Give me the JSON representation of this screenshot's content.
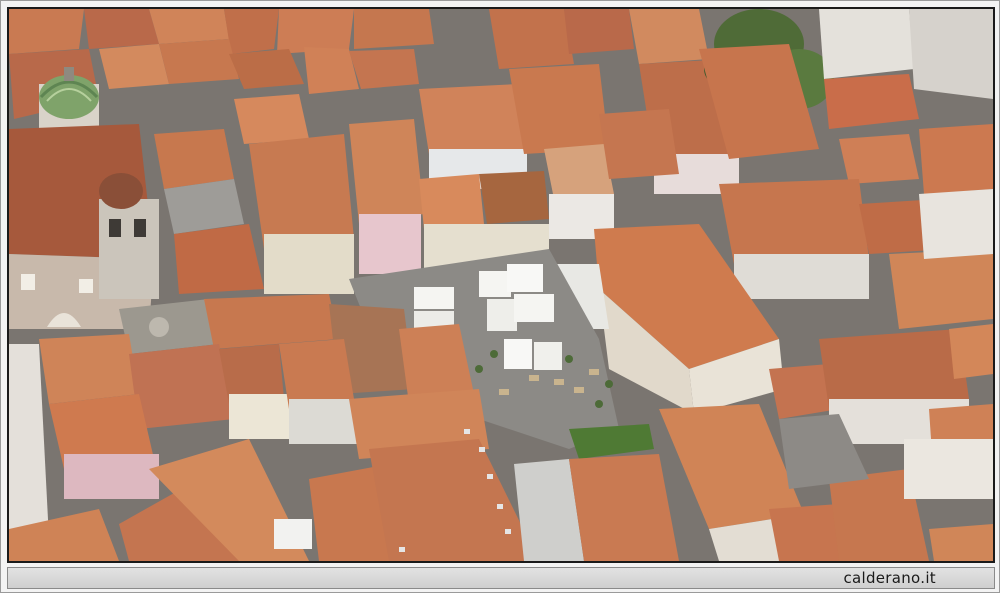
{
  "photo": {
    "subject": "aerial-view-town-rooftops-piazza"
  },
  "caption": {
    "watermark": "calderano.it"
  },
  "colors": {
    "roof_terracotta": "#c8774e",
    "roof_dark": "#a35a3a",
    "wall_light": "#e9e4dc",
    "piazza_stone": "#8c8a86",
    "umbrella_white": "#f5f5f2",
    "greenery": "#4f6b37",
    "dome_green": "#7fa36a",
    "caption_bg": "#d8d8d8"
  }
}
